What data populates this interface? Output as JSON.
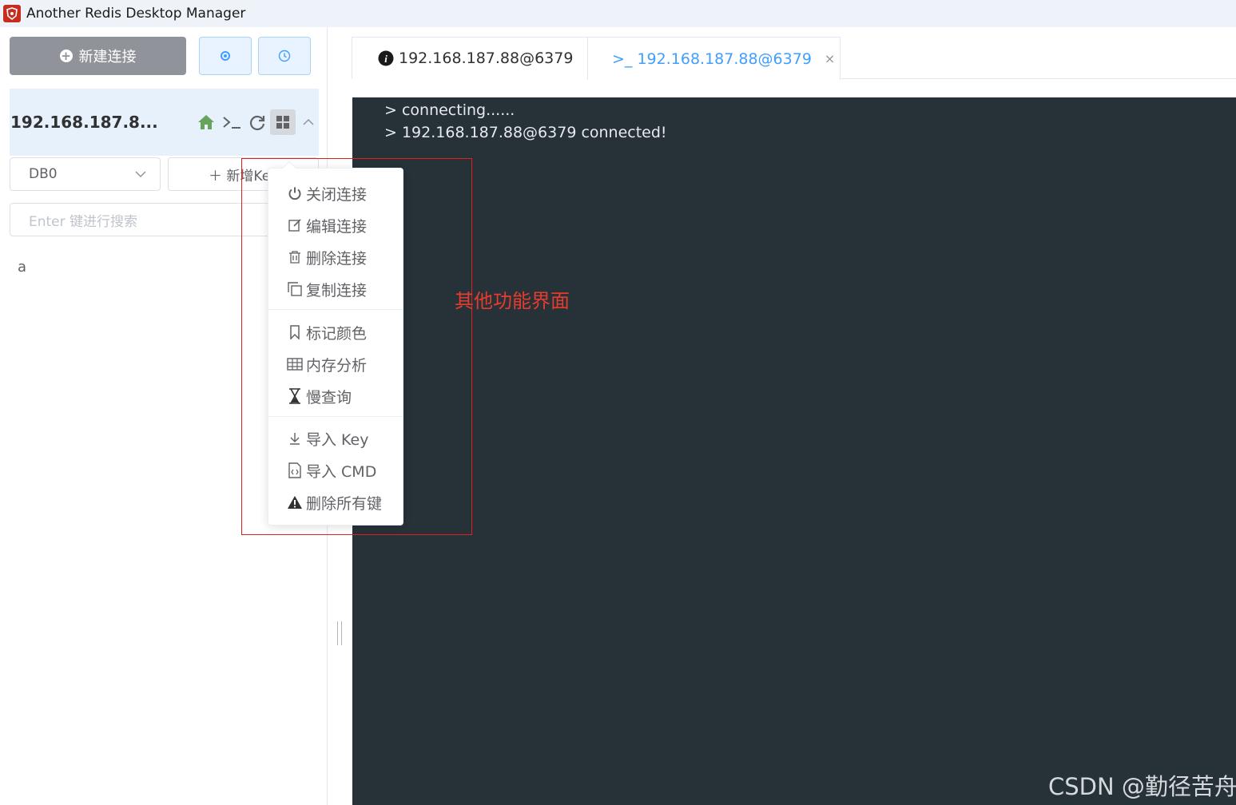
{
  "window": {
    "title": "Another Redis Desktop Manager"
  },
  "sidebar": {
    "new_connection_label": "新建连接",
    "connection": {
      "name": "192.168.187.8..."
    },
    "db_select": {
      "value": "DB0"
    },
    "add_key_label": "＋ 新增Key",
    "search": {
      "placeholder": "Enter 键进行搜索"
    },
    "keys": [
      "a"
    ]
  },
  "tabs": [
    {
      "label": "192.168.187.88@6379",
      "icon": "info-icon"
    },
    {
      "label": ">_ 192.168.187.88@6379",
      "icon": "terminal-icon",
      "close": "×"
    }
  ],
  "console": {
    "lines": [
      "> connecting......",
      "> 192.168.187.88@6379 connected!"
    ]
  },
  "menu": {
    "items": [
      {
        "label": "关闭连接",
        "icon": "power-icon"
      },
      {
        "label": "编辑连接",
        "icon": "edit-icon"
      },
      {
        "label": "删除连接",
        "icon": "trash-icon"
      },
      {
        "label": "复制连接",
        "icon": "copy-icon"
      },
      {
        "label": "标记颜色",
        "icon": "bookmark-icon"
      },
      {
        "label": "内存分析",
        "icon": "table-icon"
      },
      {
        "label": "慢查询",
        "icon": "hourglass-icon"
      },
      {
        "label": "导入 Key",
        "icon": "download-icon"
      },
      {
        "label": "导入 CMD",
        "icon": "file-code-icon"
      },
      {
        "label": "删除所有键",
        "icon": "warning-icon"
      }
    ]
  },
  "annotation": "其他功能界面",
  "watermark": "CSDN @勤径苦舟",
  "colors": {
    "accent": "#409eff",
    "console_bg": "#263238",
    "annotation": "#e63b2e"
  }
}
